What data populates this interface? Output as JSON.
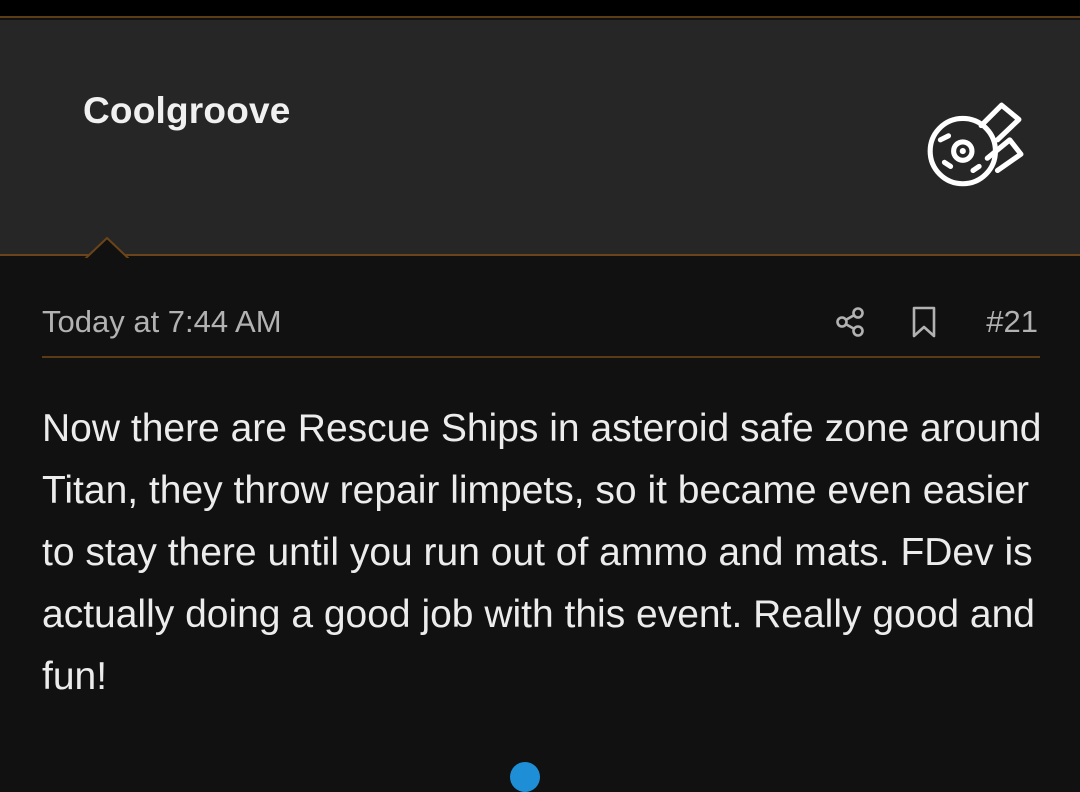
{
  "post": {
    "username": "Coolgroove",
    "timestamp": "Today at 7:44 AM",
    "post_number": "#21",
    "message": "Now there are Rescue Ships in asteroid safe zone around Titan, they throw repair limpets, so it became even easier to stay there until you run out of ammo and mats. FDev is actually doing a good job with this event. Really good and fun!"
  },
  "icons": {
    "user_badge": "millennium-falcon-icon",
    "share": "share-icon",
    "bookmark": "bookmark-icon"
  },
  "colors": {
    "accent_border": "#6b4519",
    "header_bg": "#262626",
    "body_bg": "#111111",
    "text": "#ececec",
    "muted_text": "#b2b2b2"
  }
}
